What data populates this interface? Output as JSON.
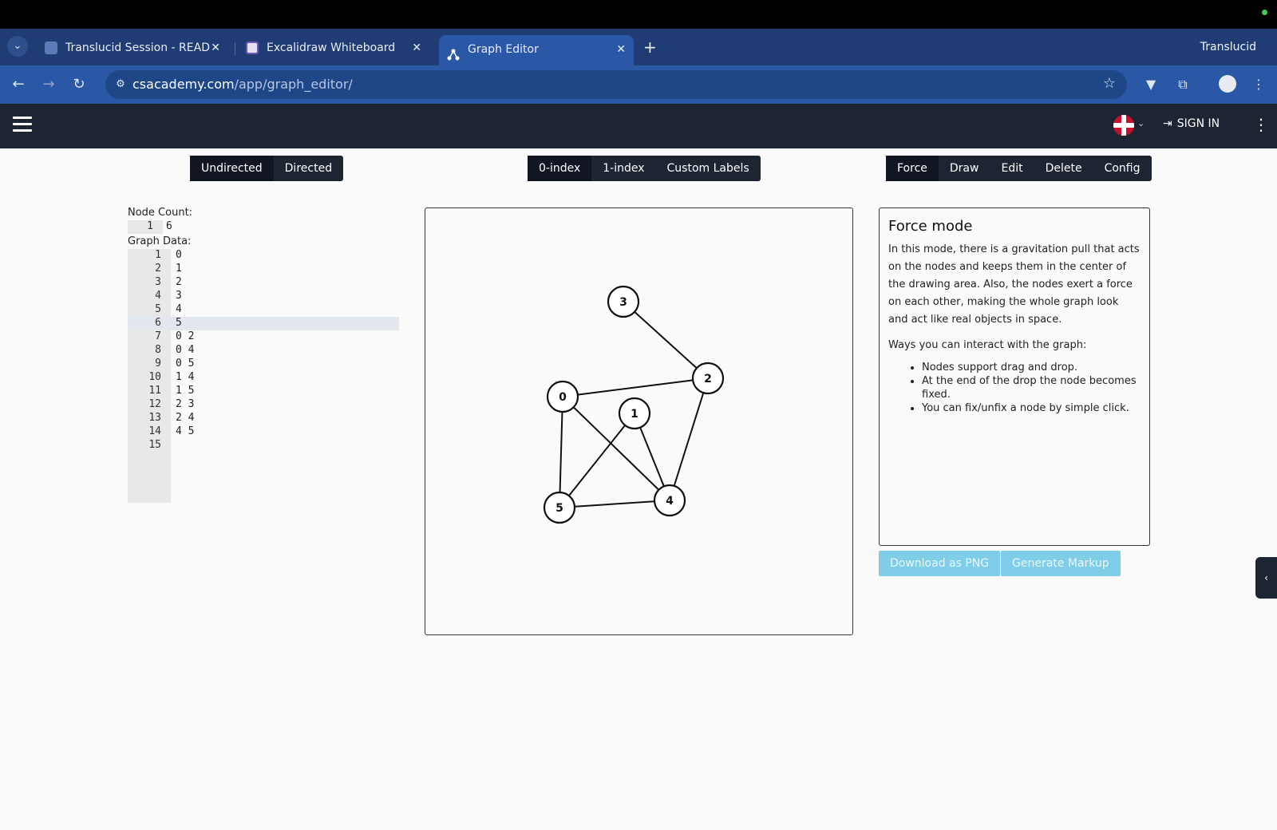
{
  "browser": {
    "tabs": [
      {
        "title": "Translucid Session - READ",
        "active": false
      },
      {
        "title": "Excalidraw Whiteboard",
        "active": false
      },
      {
        "title": "Graph Editor",
        "active": true
      }
    ],
    "close_glyph": "✕",
    "new_tab_glyph": "+",
    "profile_name": "Translucid",
    "url_host": "csacademy.com",
    "url_path": "/app/graph_editor/"
  },
  "appbar": {
    "sign_in_label": "SIGN IN"
  },
  "toolbar": {
    "direction": [
      "Undirected",
      "Directed"
    ],
    "indexing": [
      "0-index",
      "1-index",
      "Custom Labels"
    ],
    "modes": [
      "Force",
      "Draw",
      "Edit",
      "Delete",
      "Config"
    ]
  },
  "left_panel": {
    "node_count_label": "Node Count:",
    "node_count_lines": [
      {
        "n": "1",
        "text": "6"
      }
    ],
    "graph_data_label": "Graph Data:",
    "graph_data_lines": [
      {
        "n": "1",
        "text": "0"
      },
      {
        "n": "2",
        "text": "1"
      },
      {
        "n": "3",
        "text": "2"
      },
      {
        "n": "4",
        "text": "3"
      },
      {
        "n": "5",
        "text": "4"
      },
      {
        "n": "6",
        "text": "5"
      },
      {
        "n": "7",
        "text": "0 2"
      },
      {
        "n": "8",
        "text": "0 4"
      },
      {
        "n": "9",
        "text": "0 5"
      },
      {
        "n": "10",
        "text": "1 4"
      },
      {
        "n": "11",
        "text": "1 5"
      },
      {
        "n": "12",
        "text": "2 3"
      },
      {
        "n": "13",
        "text": "2 4"
      },
      {
        "n": "14",
        "text": "4 5"
      },
      {
        "n": "15",
        "text": ""
      }
    ]
  },
  "graph": {
    "nodes": [
      "0",
      "1",
      "2",
      "3",
      "4",
      "5"
    ],
    "edges": [
      [
        "0",
        "2"
      ],
      [
        "0",
        "4"
      ],
      [
        "0",
        "5"
      ],
      [
        "1",
        "4"
      ],
      [
        "1",
        "5"
      ],
      [
        "2",
        "3"
      ],
      [
        "2",
        "4"
      ],
      [
        "4",
        "5"
      ]
    ]
  },
  "info": {
    "title": "Force mode",
    "paragraph": "In this mode, there is a gravitation pull that acts on the nodes and keeps them in the center of the drawing area. Also, the nodes exert a force on each other, making the whole graph look and act like real objects in space.",
    "ways_label": "Ways you can interact with the graph:",
    "bullets": [
      "Nodes support drag and drop.",
      "At the end of the drop the node becomes fixed.",
      "You can fix/unfix a node by simple click."
    ]
  },
  "actions": {
    "download_png": "Download as PNG",
    "generate_markup": "Generate Markup"
  },
  "colors": {
    "appbar": "#1e2532",
    "tabstrip": "#1f3d74",
    "addrbar": "#2b58a6",
    "action_button": "#7fcde6"
  }
}
